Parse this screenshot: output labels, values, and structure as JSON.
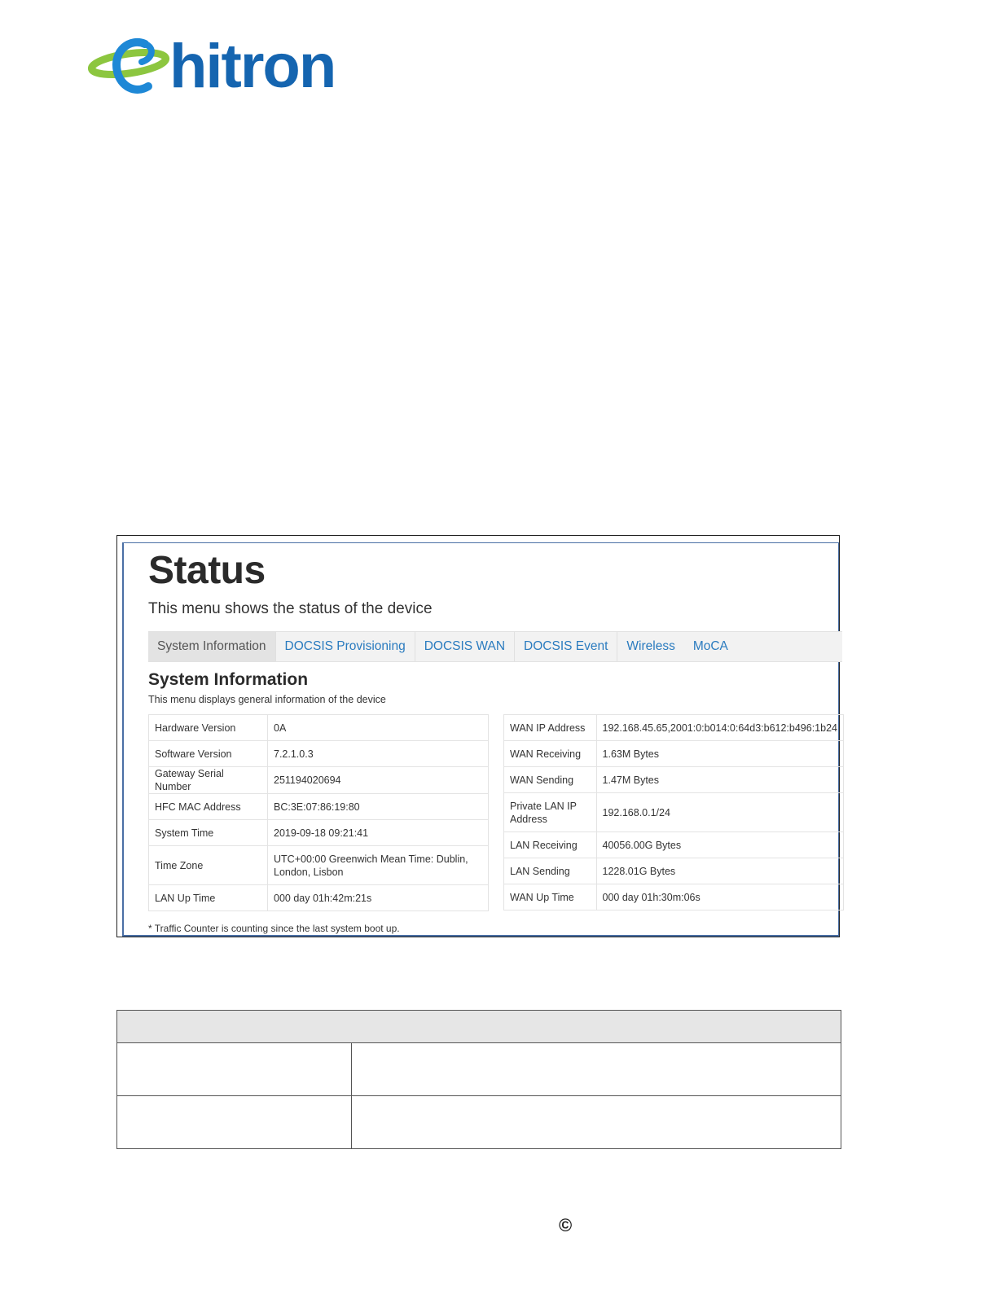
{
  "logo": {
    "text": "hitron",
    "brand_color": "#1565b0",
    "swoosh_color": "#8cc63f"
  },
  "status": {
    "title": "Status",
    "subtitle": "This menu shows the status of the device",
    "tabs": [
      {
        "label": "System Information",
        "active": true
      },
      {
        "label": "DOCSIS Provisioning",
        "active": false
      },
      {
        "label": "DOCSIS WAN",
        "active": false
      },
      {
        "label": "DOCSIS Event",
        "active": false
      },
      {
        "label": "Wireless",
        "active": false
      },
      {
        "label": "MoCA",
        "active": false
      }
    ],
    "section_title": "System Information",
    "section_subtitle": "This menu displays general information of the device",
    "left_rows": [
      {
        "label": "Hardware Version",
        "value": "0A"
      },
      {
        "label": "Software Version",
        "value": "7.2.1.0.3"
      },
      {
        "label": "Gateway Serial Number",
        "value": "251194020694"
      },
      {
        "label": "HFC MAC Address",
        "value": "BC:3E:07:86:19:80"
      },
      {
        "label": "System Time",
        "value": "2019-09-18 09:21:41"
      },
      {
        "label": "Time Zone",
        "value": "UTC+00:00 Greenwich Mean Time: Dublin, London, Lisbon"
      },
      {
        "label": "LAN Up Time",
        "value": "000 day 01h:42m:21s"
      }
    ],
    "right_rows": [
      {
        "label": "WAN IP Address",
        "value": "192.168.45.65,2001:0:b014:0:64d3:b612:b496:1b24"
      },
      {
        "label": "WAN Receiving",
        "value": "1.63M Bytes"
      },
      {
        "label": "WAN Sending",
        "value": "1.47M Bytes"
      },
      {
        "label": "Private LAN IP Address",
        "value": "192.168.0.1/24"
      },
      {
        "label": "LAN Receiving",
        "value": "40056.00G Bytes"
      },
      {
        "label": "LAN Sending",
        "value": "1228.01G Bytes"
      },
      {
        "label": "WAN Up Time",
        "value": "000 day 01h:30m:06s"
      }
    ],
    "footnote": "* Traffic Counter is counting since the last system boot up."
  },
  "footer": {
    "copyright_symbol": "©"
  }
}
